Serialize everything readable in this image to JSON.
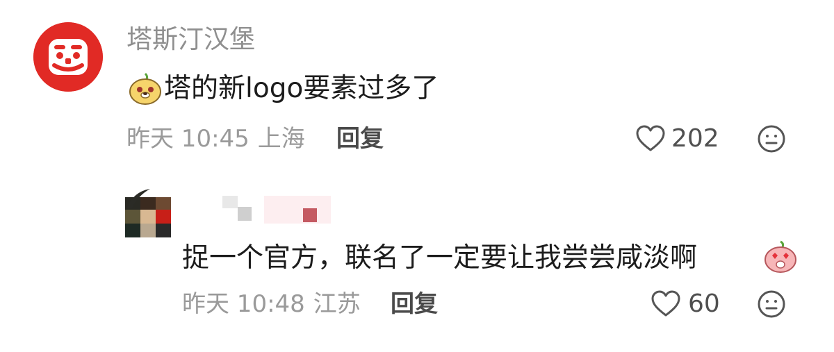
{
  "comments": [
    {
      "username": "塔斯汀汉堡",
      "content": "塔的新logo要素过多了",
      "time": "昨天 10:45",
      "location": "上海",
      "reply_label": "回复",
      "likes": "202",
      "avatar_icon": "tastien-logo-icon",
      "leading_emoji": "pear-dog-emoji-icon"
    },
    {
      "username": "",
      "content": "捉一个官方，联名了一定要让我尝尝咸淡啊",
      "time": "昨天 10:48",
      "location": "江苏",
      "reply_label": "回复",
      "likes": "60",
      "trailing_emoji": "peach-heart-eyes-emoji-icon"
    }
  ],
  "colors": {
    "brand_red": "#e12a25",
    "meta_gray": "#9a9a9a",
    "text_dark": "#1c1c1c"
  }
}
